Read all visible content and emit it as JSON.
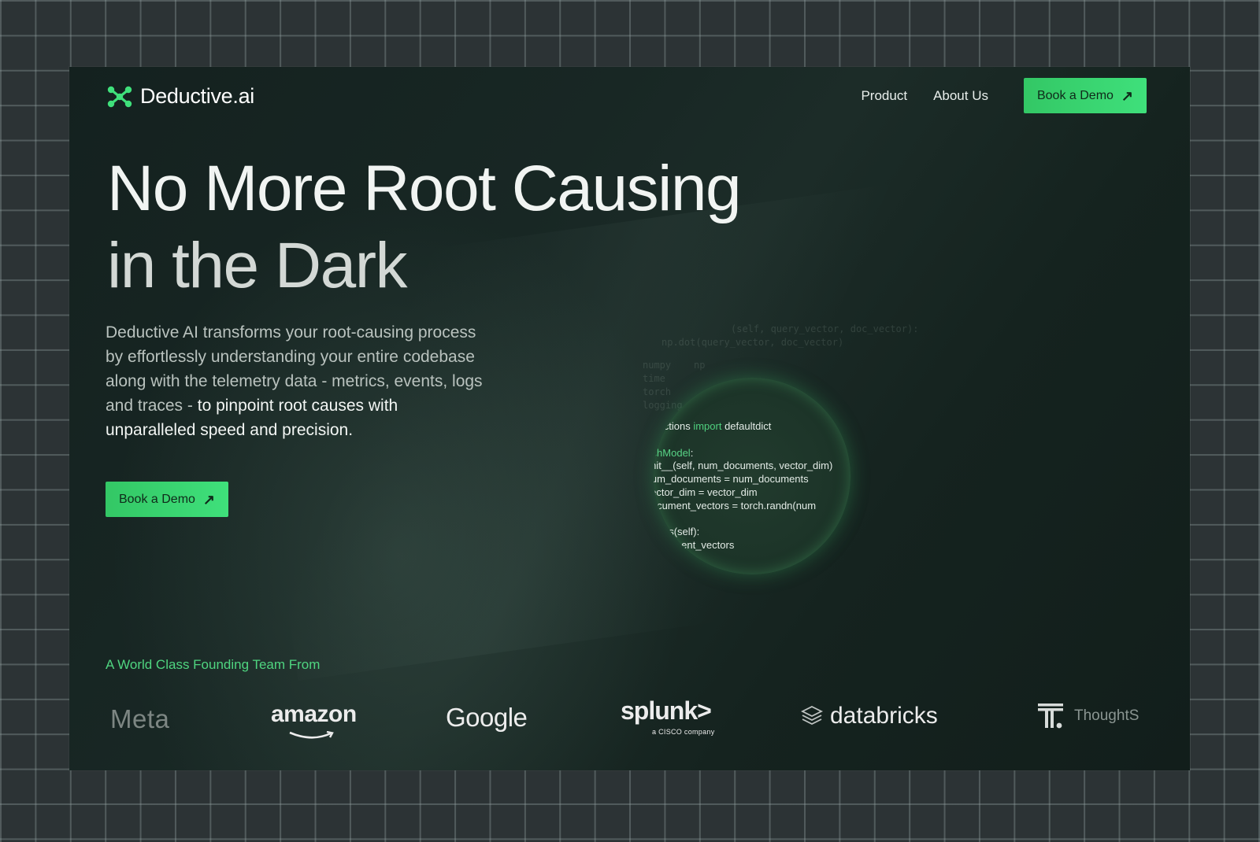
{
  "brand": {
    "name": "Deductive.ai",
    "icon": "deductive-logo-icon"
  },
  "nav": {
    "links": [
      "Product",
      "About Us"
    ],
    "cta": "Book a Demo",
    "cta_icon": "arrow-up-right-icon"
  },
  "hero": {
    "title_line1": "No More Root Causing",
    "title_line2": "in the Dark",
    "description": "Deductive AI transforms your root-causing process by effortlessly understanding your entire codebase along with the telemetry data - metrics, events, logs and traces - ",
    "description_highlight": "to pinpoint root causes with unparalleled speed and precision.",
    "cta": "Book a Demo"
  },
  "code_lens": {
    "ghost_lines": [
      "(self, query_vector, doc_vector):",
      "np.dot(query_vector, doc_vector)",
      "numpy    np",
      "time",
      "torch",
      "logging",
      "collections"
    ],
    "import_keyword": "import",
    "import_name": "defaultdict",
    "line_collections": "collections",
    "line_class": "archModel",
    "line_init": "_init__(self, num_documents, vector_dim)",
    "line_numdocs": ".num_documents = num_documents",
    "line_vecdim": ".vector_dim = vector_dim",
    "line_docvec": ".document_vectors = torch.randn(num",
    "line_params": "meters(self):",
    "line_return": "lf.document_vectors"
  },
  "team": {
    "label": "A World Class Founding Team From",
    "logos": [
      "Meta",
      "amazon",
      "Google",
      "splunk>",
      "a CISCO company",
      "databricks",
      "ThoughtS"
    ]
  },
  "colors": {
    "accent": "#3fe07b",
    "accent_text": "#4fd580",
    "card_bg": "#172522",
    "page_bg": "#2c3335"
  }
}
